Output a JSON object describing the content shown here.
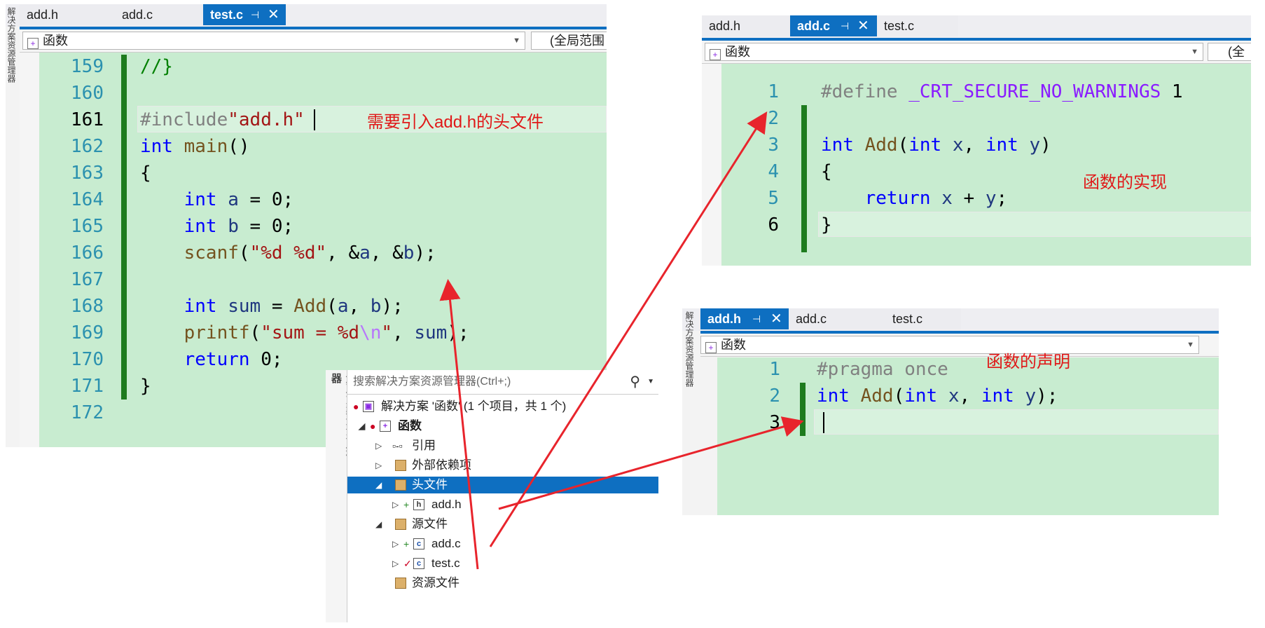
{
  "panel1": {
    "tabs": {
      "t1": "add.h",
      "t2": "add.c",
      "t3": "test.c",
      "pin": "⊣",
      "close": "✕"
    },
    "nav": {
      "scope": "函数",
      "right": "(全局范围"
    },
    "side_label": "解决方案资源管理器",
    "lines": [
      "159",
      "160",
      "161",
      "162",
      "163",
      "164",
      "165",
      "166",
      "167",
      "168",
      "169",
      "170",
      "171",
      "172"
    ],
    "code": {
      "l159": "//}",
      "l161_pp": "#include",
      "l161_str": "\"add.h\"",
      "l162_kw": "int",
      "l162_fn": "main",
      "l162_rest": "()",
      "l163": "{",
      "l164_kw": "int",
      "l164_var": "a",
      "l164_rest": " = 0;",
      "l165_kw": "int",
      "l165_var": "b",
      "l165_rest": " = 0;",
      "l166_fn": "scanf",
      "l166_str": "\"%d %d\"",
      "l166_a": "a",
      "l166_b": "b",
      "l168_kw": "int",
      "l168_var": "sum",
      "l168_fn": "Add",
      "l168_a": "a",
      "l168_b": "b",
      "l169_fn": "printf",
      "l169_str1": "\"sum = %d",
      "l169_esc": "\\n",
      "l169_str2": "\"",
      "l169_sum": "sum",
      "l170_kw": "return",
      "l170_rest": " 0;",
      "l171": "}"
    },
    "annotation": "需要引入add.h的头文件"
  },
  "panel2": {
    "tabs": {
      "t1": "add.h",
      "t2": "add.c",
      "t3": "test.c",
      "pin": "⊣",
      "close": "✕"
    },
    "nav": {
      "scope": "函数",
      "right": "(全"
    },
    "lines": [
      "1",
      "2",
      "3",
      "4",
      "5",
      "6"
    ],
    "code": {
      "l1_pp": "#define",
      "l1_macro": "_CRT_SECURE_NO_WARNINGS",
      "l1_num": "1",
      "l3_kw1": "int",
      "l3_fn": "Add",
      "l3_kw2": "int",
      "l3_x": "x",
      "l3_kw3": "int",
      "l3_y": "y",
      "l4": "{",
      "l5_kw": "return",
      "l5_x": "x",
      "l5_y": "y",
      "l6": "}"
    },
    "annotation": "函数的实现"
  },
  "panel3": {
    "tabs": {
      "t1": "add.h",
      "t2": "add.c",
      "t3": "test.c",
      "pin": "⊣",
      "close": "✕"
    },
    "nav": {
      "scope": "函数"
    },
    "side_label": "解决方案资源管理器",
    "lines": [
      "1",
      "2",
      "3"
    ],
    "code": {
      "l1": "#pragma once",
      "l2_kw1": "int",
      "l2_fn": "Add",
      "l2_kw2": "int",
      "l2_x": "x",
      "l2_kw3": "int",
      "l2_y": "y"
    },
    "annotation": "函数的声明"
  },
  "explorer": {
    "side_label": "解决方案资源管理器",
    "search_placeholder": "搜索解决方案资源管理器(Ctrl+;)",
    "items": [
      {
        "label": "解决方案 '函数' (1 个项目，共 1 个)"
      },
      {
        "label": "函数"
      },
      {
        "label": "引用"
      },
      {
        "label": "外部依赖项"
      },
      {
        "label": "头文件"
      },
      {
        "label": "add.h"
      },
      {
        "label": "源文件"
      },
      {
        "label": "add.c"
      },
      {
        "label": "test.c"
      },
      {
        "label": "资源文件"
      }
    ]
  },
  "colors": {
    "accent": "#0e6fc1",
    "code_bg": "#c8ecd0",
    "annotation": "#e01818",
    "arrow": "#e8242c"
  }
}
